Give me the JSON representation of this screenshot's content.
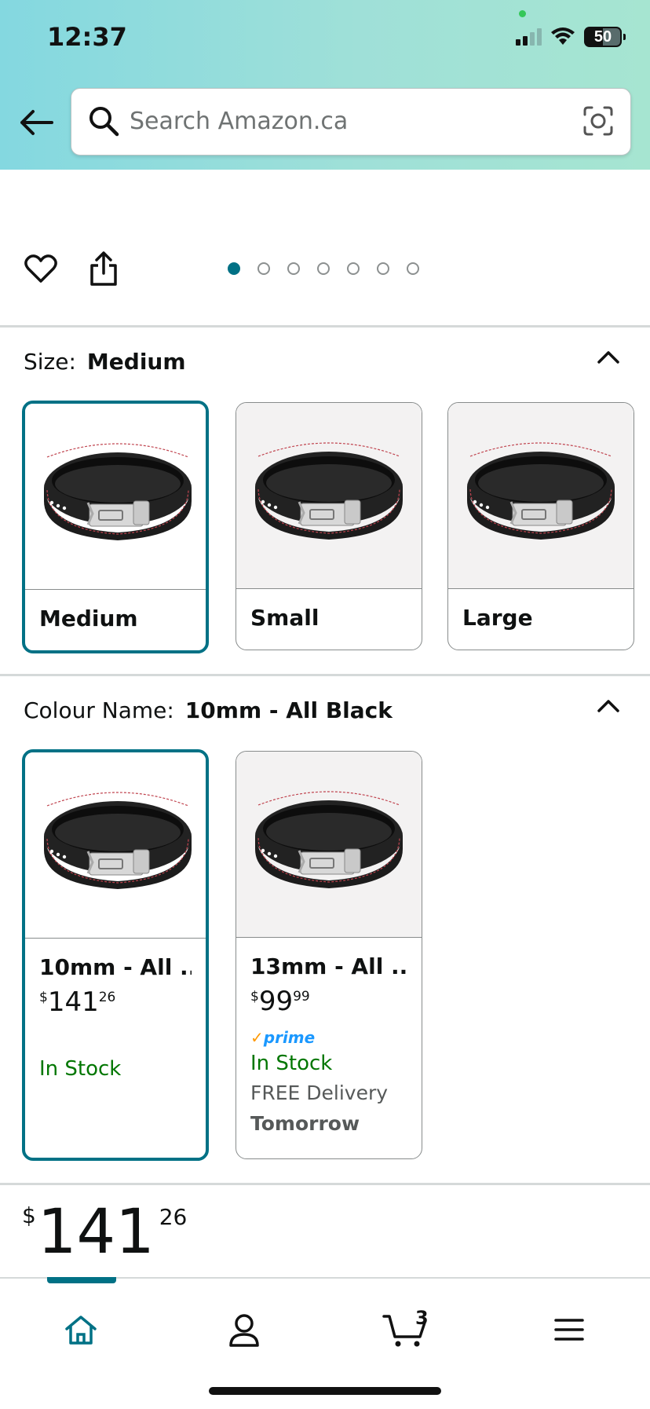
{
  "status_bar": {
    "time": "12:37",
    "battery": "50"
  },
  "search": {
    "placeholder": "Search Amazon.ca"
  },
  "gallery": {
    "dot_count": 7,
    "active_index": 0
  },
  "size_section": {
    "label": "Size:",
    "selected_value": "Medium",
    "options": [
      {
        "name": "Medium",
        "selected": true
      },
      {
        "name": "Small",
        "selected": false
      },
      {
        "name": "Large",
        "selected": false
      }
    ]
  },
  "colour_section": {
    "label": "Colour Name:",
    "selected_value": "10mm - All Black",
    "options": [
      {
        "title": "10mm - All ...",
        "currency": "$",
        "price_whole": "141",
        "price_cents": "26",
        "stock": "In Stock",
        "selected": true
      },
      {
        "title": "13mm - All ...",
        "currency": "$",
        "price_whole": "99",
        "price_cents": "99",
        "prime": "prime",
        "stock": "In Stock",
        "delivery_line1": "FREE Delivery",
        "delivery_line2": "Tomorrow",
        "selected": false
      }
    ]
  },
  "price": {
    "currency": "$",
    "whole": "141",
    "cents": "26"
  },
  "bottom_nav": {
    "items": [
      "home-icon",
      "account-icon",
      "cart-icon",
      "menu-icon"
    ],
    "cart_count": "3",
    "active": "home"
  },
  "colors": {
    "accent": "#007185",
    "in_stock": "#007600",
    "prime": "#1a98ff"
  }
}
